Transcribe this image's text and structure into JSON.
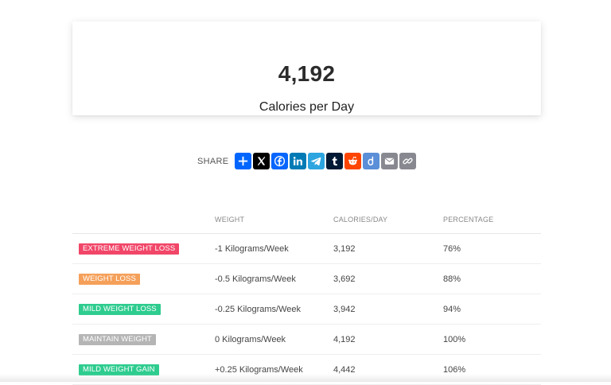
{
  "result": {
    "value": "4,192",
    "unit": "Calories per Day"
  },
  "share": {
    "label": "SHARE",
    "buttons": [
      {
        "name": "share-add-icon",
        "color": "#0166ff"
      },
      {
        "name": "x-icon",
        "color": "#000000"
      },
      {
        "name": "facebook-icon",
        "color": "#0866ff"
      },
      {
        "name": "linkedin-icon",
        "color": "#007bb5"
      },
      {
        "name": "telegram-icon",
        "color": "#2ca5e0"
      },
      {
        "name": "tumblr-icon",
        "color": "#001935"
      },
      {
        "name": "reddit-icon",
        "color": "#ff4500"
      },
      {
        "name": "diaspora-icon",
        "color": "#5b8fd8"
      },
      {
        "name": "email-icon",
        "color": "#888990"
      },
      {
        "name": "copy-link-icon",
        "color": "#888990"
      }
    ]
  },
  "table": {
    "headers": {
      "weight": "WEIGHT",
      "calories": "CALORIES/DAY",
      "percentage": "PERCENTAGE"
    },
    "rows": [
      {
        "label": "EXTREME WEIGHT LOSS",
        "color": "#f14668",
        "weight": "-1 Kilograms/Week",
        "calories": "3,192",
        "percentage": "76%"
      },
      {
        "label": "WEIGHT LOSS",
        "color": "#f5a05a",
        "weight": "-0.5 Kilograms/Week",
        "calories": "3,692",
        "percentage": "88%"
      },
      {
        "label": "MILD WEIGHT LOSS",
        "color": "#2ecc8f",
        "weight": "-0.25 Kilograms/Week",
        "calories": "3,942",
        "percentage": "94%"
      },
      {
        "label": "MAINTAIN WEIGHT",
        "color": "#b5b5b5",
        "weight": "0 Kilograms/Week",
        "calories": "4,192",
        "percentage": "100%"
      },
      {
        "label": "MILD WEIGHT GAIN",
        "color": "#2ecc8f",
        "weight": "+0.25 Kilograms/Week",
        "calories": "4,442",
        "percentage": "106%"
      }
    ]
  }
}
